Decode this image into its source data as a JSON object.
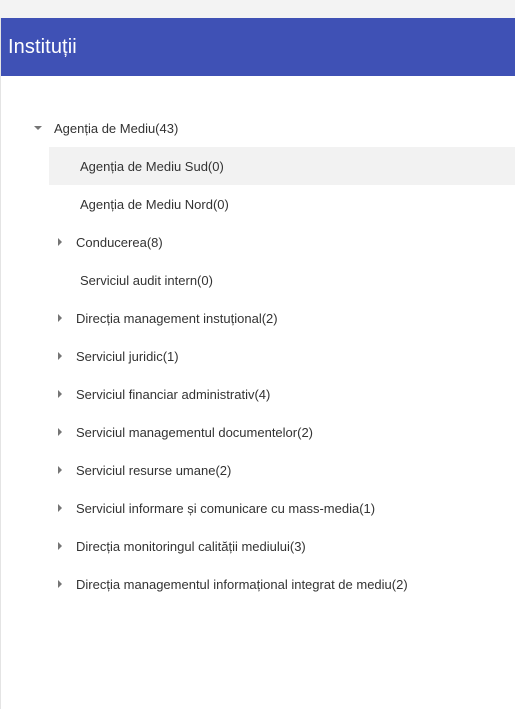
{
  "panel": {
    "title": "Instituții"
  },
  "tree": {
    "root": {
      "label": "Agenția de Mediu(43)",
      "expanded": true
    },
    "children": [
      {
        "label": "Agenția de Mediu Sud(0)",
        "has_children": false,
        "selected": true
      },
      {
        "label": "Agenția de Mediu Nord(0)",
        "has_children": false
      },
      {
        "label": "Conducerea(8)",
        "has_children": true
      },
      {
        "label": "Serviciul audit intern(0)",
        "has_children": false
      },
      {
        "label": "Direcția management instuțional(2)",
        "has_children": true
      },
      {
        "label": "Serviciul juridic(1)",
        "has_children": true
      },
      {
        "label": "Serviciul financiar administrativ(4)",
        "has_children": true
      },
      {
        "label": "Serviciul managementul documentelor(2)",
        "has_children": true
      },
      {
        "label": "Serviciul resurse umane(2)",
        "has_children": true
      },
      {
        "label": "Serviciul informare și comunicare cu mass-media(1)",
        "has_children": true
      },
      {
        "label": "Direcția monitoringul calității mediului(3)",
        "has_children": true
      },
      {
        "label": "Direcția managementul informațional integrat de mediu(2)",
        "has_children": true
      }
    ]
  },
  "colors": {
    "header_bg": "#3f51b5",
    "header_text": "#ffffff",
    "selected_bg": "#f2f2f2",
    "text": "#333333",
    "caret": "#757575"
  },
  "icons": {
    "expanded": "caret-down-icon",
    "collapsed": "caret-right-icon"
  }
}
